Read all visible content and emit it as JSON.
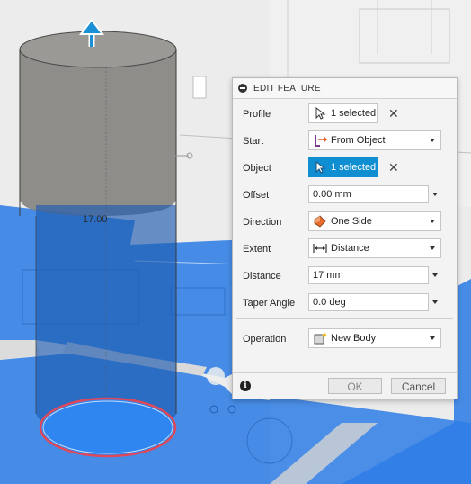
{
  "panel": {
    "title": "EDIT FEATURE",
    "rows": {
      "profile": {
        "label": "Profile",
        "value": "1 selected"
      },
      "start": {
        "label": "Start",
        "value": "From Object"
      },
      "object": {
        "label": "Object",
        "value": "1 selected"
      },
      "offset": {
        "label": "Offset",
        "value": "0.00 mm"
      },
      "direction": {
        "label": "Direction",
        "value": "One Side"
      },
      "extent": {
        "label": "Extent",
        "value": "Distance"
      },
      "distance": {
        "label": "Distance",
        "value": "17 mm"
      },
      "taper": {
        "label": "Taper Angle",
        "value": "0.0 deg"
      },
      "operation": {
        "label": "Operation",
        "value": "New Body"
      }
    },
    "ok_label": "OK",
    "cancel_label": "Cancel",
    "info_glyph": "i"
  },
  "viewport": {
    "dimension_label": "17.00"
  },
  "colors": {
    "accent": "#0f8fd2",
    "selection_blue": "#2f7ee6",
    "body_grey": "#8c8a86"
  }
}
